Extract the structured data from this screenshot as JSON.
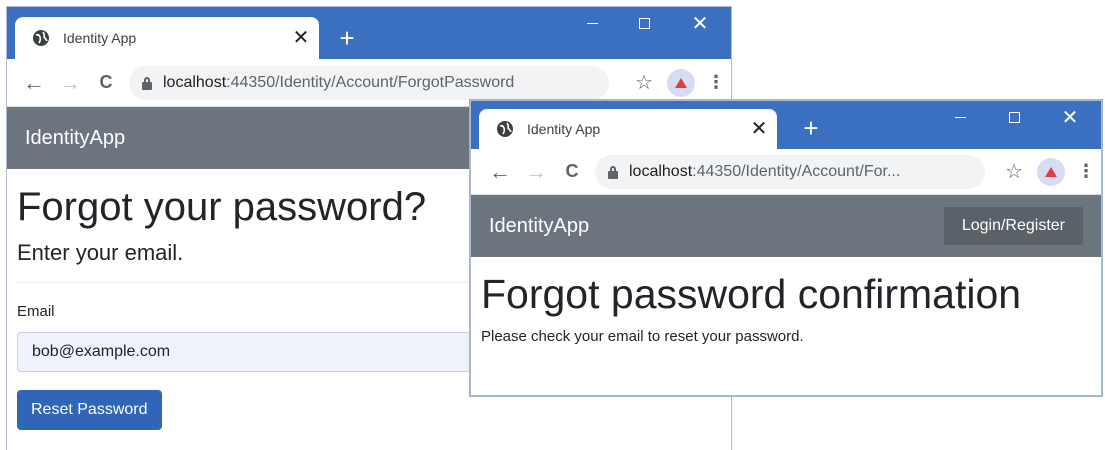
{
  "back_window": {
    "tab": {
      "title": "Identity App",
      "close": "✕",
      "new_tab": "+"
    },
    "window_controls": {
      "close": "✕"
    },
    "address": {
      "host": "localhost",
      "path": ":44350/Identity/Account/ForgotPassword"
    },
    "navbar": {
      "brand": "IdentityApp"
    },
    "content": {
      "heading": "Forgot your password?",
      "subheading": "Enter your email.",
      "email_label": "Email",
      "email_value": "bob@example.com",
      "submit_label": "Reset Password"
    }
  },
  "front_window": {
    "tab": {
      "title": "Identity App",
      "close": "✕",
      "new_tab": "+"
    },
    "window_controls": {
      "close": "✕"
    },
    "address": {
      "host": "localhost",
      "path": ":44350/Identity/Account/For..."
    },
    "navbar": {
      "brand": "IdentityApp",
      "login_label": "Login/Register"
    },
    "content": {
      "heading": "Forgot password confirmation",
      "message": "Please check your email to reset your password."
    }
  },
  "icons": {
    "back": "←",
    "forward": "→",
    "reload": "C",
    "star": "☆",
    "menu": "⋮"
  },
  "colors": {
    "titlebar": "#3a70bf",
    "navbar": "#6c757d",
    "primary_button": "#2f66b8",
    "profile_bg": "#d6dcf4",
    "profile_accent": "#e03d3d"
  }
}
